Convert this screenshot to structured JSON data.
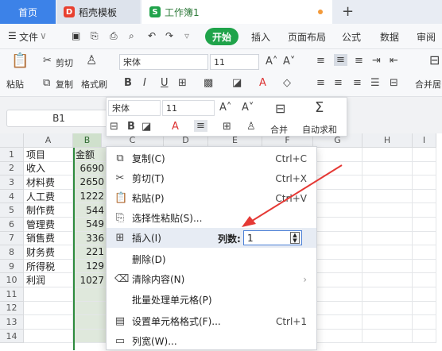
{
  "tabs": {
    "home": "首页",
    "template": "稻壳模板",
    "workbook": "工作簿1",
    "new": "+"
  },
  "menu": {
    "file": "文件",
    "start": "开始",
    "insert": "插入",
    "layout": "页面布局",
    "formula": "公式",
    "data": "数据",
    "review": "审阅"
  },
  "ribbon": {
    "paste": "粘贴",
    "cut": "剪切",
    "copy": "复制",
    "format_painter": "格式刷",
    "font": "宋体",
    "font_size": "11",
    "merge": "合并居"
  },
  "formula_bar": {
    "name_box": "B1"
  },
  "mini_toolbar": {
    "font": "宋体",
    "font_size": "11",
    "merge": "合并",
    "autosum": "自动求和"
  },
  "columns": [
    "A",
    "B",
    "C",
    "D",
    "E",
    "F",
    "G",
    "H",
    "I"
  ],
  "rows": [
    {
      "n": "1",
      "a": "项目",
      "b": "金额"
    },
    {
      "n": "2",
      "a": "收入",
      "b": "6690"
    },
    {
      "n": "3",
      "a": "材料费",
      "b": "2650"
    },
    {
      "n": "4",
      "a": "人工费",
      "b": "1222"
    },
    {
      "n": "5",
      "a": "制作费",
      "b": "544"
    },
    {
      "n": "6",
      "a": "管理费",
      "b": "549"
    },
    {
      "n": "7",
      "a": "销售费",
      "b": "336"
    },
    {
      "n": "8",
      "a": "财务费",
      "b": "221"
    },
    {
      "n": "9",
      "a": "所得税",
      "b": "129"
    },
    {
      "n": "10",
      "a": "利润",
      "b": "1027"
    },
    {
      "n": "11",
      "a": "",
      "b": ""
    },
    {
      "n": "12",
      "a": "",
      "b": ""
    },
    {
      "n": "13",
      "a": "",
      "b": ""
    },
    {
      "n": "14",
      "a": "",
      "b": ""
    }
  ],
  "context_menu": [
    {
      "label": "复制(C)",
      "shortcut": "Ctrl+C",
      "icon": "copy-icon"
    },
    {
      "label": "剪切(T)",
      "shortcut": "Ctrl+X",
      "icon": "scissors-icon"
    },
    {
      "label": "粘贴(P)",
      "shortcut": "Ctrl+V",
      "icon": "paste-icon"
    },
    {
      "label": "选择性粘贴(S)...",
      "shortcut": "",
      "icon": "paste-special-icon"
    },
    {
      "label": "插入(I)",
      "shortcut": "",
      "icon": "insert-icon",
      "count_label": "列数:",
      "count_value": "1"
    },
    {
      "label": "删除(D)",
      "shortcut": "",
      "icon": ""
    },
    {
      "label": "清除内容(N)",
      "shortcut": "",
      "icon": "eraser-icon"
    },
    {
      "label": "批量处理单元格(P)",
      "shortcut": "",
      "icon": ""
    },
    {
      "label": "设置单元格格式(F)...",
      "shortcut": "Ctrl+1",
      "icon": "format-cells-icon"
    },
    {
      "label": "列宽(W)...",
      "shortcut": "",
      "icon": "column-width-icon"
    }
  ]
}
